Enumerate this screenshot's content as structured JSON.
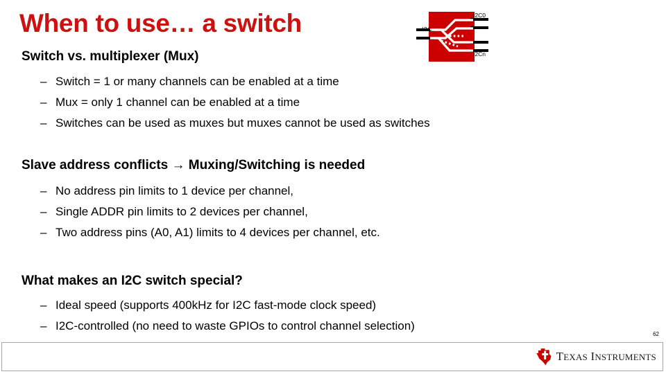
{
  "slide": {
    "title": "When to use… a switch",
    "page_number": "62",
    "title_color": "#cc1111"
  },
  "sections": [
    {
      "heading": "Switch vs. multiplexer (Mux)",
      "bullets": [
        {
          "dash": "–",
          "text": "Switch = 1 or many channels can be enabled at a time"
        },
        {
          "dash": "–",
          "text": "Mux = only 1 channel can be enabled at a time"
        },
        {
          "dash": "–",
          "text": "Switches can be used as muxes but muxes cannot be used as switches"
        }
      ]
    },
    {
      "heading": "Slave address conflicts → Muxing/Switching is needed",
      "bullets": [
        {
          "dash": "–",
          "text": "No address pin limits to 1 device per channel,"
        },
        {
          "dash": "–",
          "text": "Single ADDR pin limits to 2 devices per channel,"
        },
        {
          "dash": "–",
          "text": "Two address pins (A0, A1)  limits to 4 devices per channel, etc."
        }
      ]
    },
    {
      "heading": "What makes an I2C switch special?",
      "bullets": [
        {
          "dash": "–",
          "text": "Ideal speed (supports 400kHz for I2C fast-mode clock speed)"
        },
        {
          "dash": "–",
          "text": "I2C-controlled (no need to waste GPIOs to control channel selection)"
        }
      ]
    }
  ],
  "diagram": {
    "name": "i2c-switch-block-diagram",
    "body_color": "#cc0000",
    "pin_color": "#000000",
    "trace_color": "#ffffff",
    "labels": {
      "input": "I2C",
      "output_first": "I2C0",
      "output_last": "I2Cn"
    }
  },
  "footer": {
    "logo_text_texas": "T",
    "logo_text_texas_rest": "EXAS",
    "logo_text_instruments": "I",
    "logo_text_instruments_rest": "NSTRUMENTS",
    "brand": "Texas Instruments",
    "logo_color": "#cc0000"
  }
}
